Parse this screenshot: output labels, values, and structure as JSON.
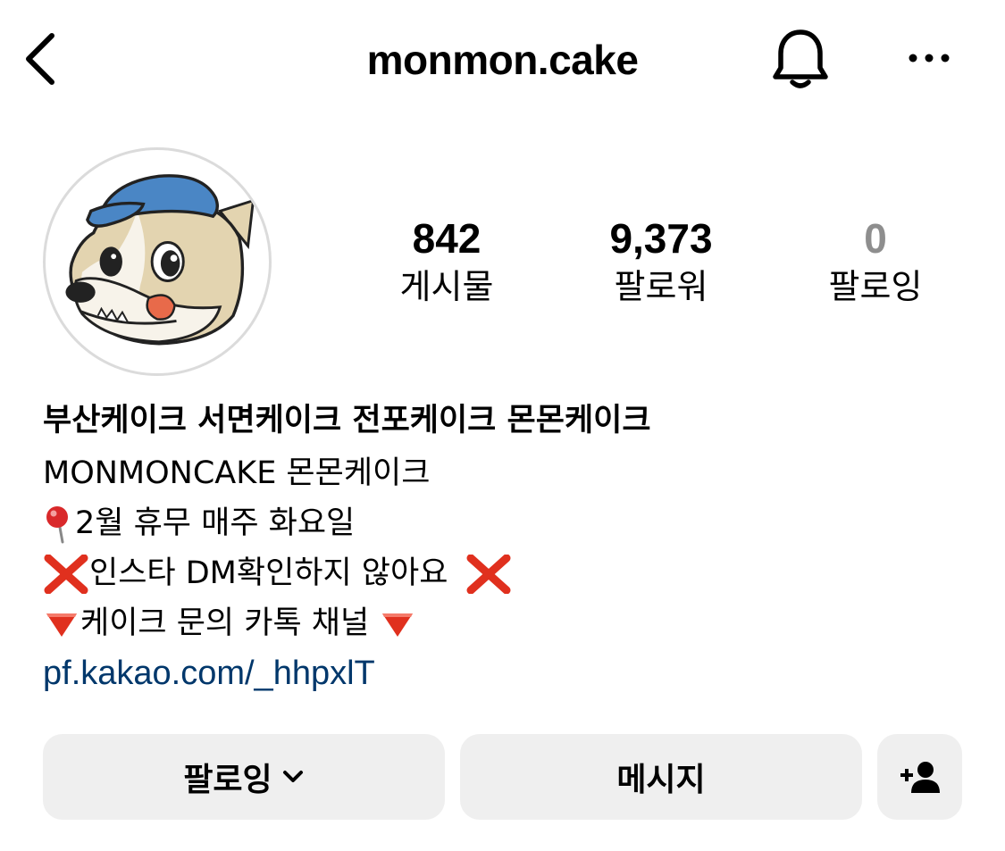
{
  "header": {
    "back_icon": "chevron-left-icon",
    "username": "monmon.cake",
    "notification_icon": "bell-icon",
    "more_icon": "more-horizontal-icon"
  },
  "profile": {
    "avatar_icon": "dog-mascot-avatar",
    "stats": {
      "posts": {
        "count": "842",
        "label": "게시물"
      },
      "followers": {
        "count": "9,373",
        "label": "팔로워"
      },
      "following": {
        "count": "0",
        "label": "팔로잉"
      }
    }
  },
  "bio": {
    "name": "부산케이크 서면케이크 전포케이크 몬몬케이크",
    "line1": "MONMONCAKE 몬몬케이크",
    "line2_text": "2월 휴무 매주 화요일",
    "line3_text": "인스타 DM확인하지 않아요",
    "line4_text": "케이크 문의 카톡 채널",
    "link": "pf.kakao.com/_hhpxlT",
    "emoji": {
      "pin": "round-pushpin",
      "cross": "cross-mark",
      "triangle": "red-triangle-down"
    }
  },
  "actions": {
    "following_label": "팔로잉",
    "message_label": "메시지",
    "add_user_icon": "add-user-icon"
  },
  "colors": {
    "link": "#00376b",
    "button_bg": "#efefef",
    "muted": "#8e8e8e",
    "emoji_red": "#e0301e",
    "avatar_hat": "#4a86c5"
  }
}
